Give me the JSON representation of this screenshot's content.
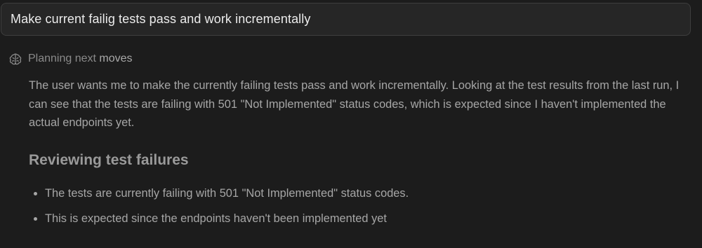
{
  "prompt": {
    "text": "Make current failig tests pass and work incrementally"
  },
  "status": {
    "icon": "brain-icon",
    "label_dim": "Planning next ",
    "label_accent": "moves"
  },
  "thinking": {
    "paragraph": "The user wants me to make the currently failing tests pass and work incrementally. Looking at the test results from the last run, I can see that the tests are failing with 501 \"Not Implemented\" status codes, which is expected since I haven't implemented the actual endpoints yet."
  },
  "section": {
    "heading": "Reviewing test failures",
    "bullets": [
      "The tests are currently failing with 501 \"Not Implemented\" status codes.",
      "This is expected since the endpoints haven't been implemented yet"
    ]
  },
  "colors": {
    "background": "#1c1c1c",
    "prompt_background": "#262626",
    "prompt_border": "#3e3e3e",
    "primary_text": "#ececec",
    "secondary_text": "#a6a6a6",
    "dim_text": "#8a8a8a"
  }
}
